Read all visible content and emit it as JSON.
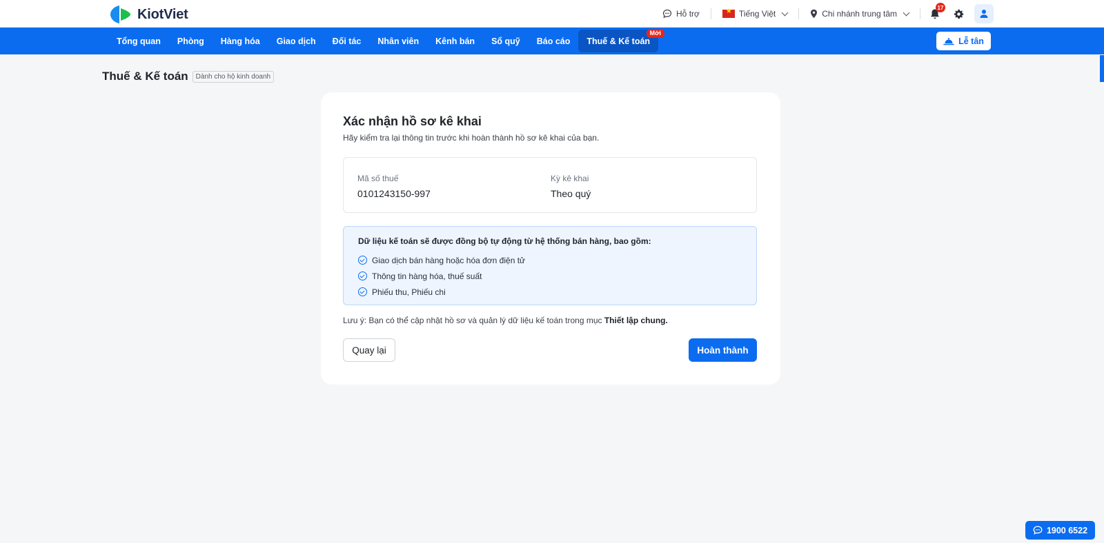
{
  "app": {
    "brand": "KiotViet",
    "colors": {
      "primary": "#0b6cf0",
      "primary_dark": "#0a55c4",
      "danger": "#e5271c",
      "background": "#f5f6f8"
    }
  },
  "header": {
    "support_label": "Hỗ trợ",
    "language_label": "Tiếng Việt",
    "branch_label": "Chi nhánh trung tâm",
    "notification_count": "17",
    "icons": [
      "chat-bubble-icon",
      "vietnam-flag-icon",
      "location-pin-icon",
      "bell-icon",
      "gear-icon",
      "user-icon"
    ]
  },
  "nav": {
    "items": [
      {
        "label": "Tổng quan"
      },
      {
        "label": "Phòng"
      },
      {
        "label": "Hàng hóa"
      },
      {
        "label": "Giao dịch"
      },
      {
        "label": "Đối tác"
      },
      {
        "label": "Nhân viên"
      },
      {
        "label": "Kênh bán"
      },
      {
        "label": "Sổ quỹ"
      },
      {
        "label": "Báo cáo"
      },
      {
        "label": "Thuế & Kế toán",
        "active": true,
        "badge": "Mới"
      }
    ],
    "reception_label": "Lễ tân"
  },
  "page": {
    "title": "Thuế & Kế toán",
    "tag": "Dành cho hộ kinh doanh"
  },
  "card": {
    "title": "Xác nhận hồ sơ kê khai",
    "subtitle": "Hãy kiểm tra lại thông tin trước khi hoàn thành hồ sơ kê khai của bạn.",
    "tax_code_label": "Mã số thuế",
    "tax_code_value": "0101243150-997",
    "period_label": "Kỳ kê khai",
    "period_value": "Theo quý",
    "sync_title": "Dữ liệu kế toán sẽ được đồng bộ tự động từ hệ thống bán hàng, bao gồm:",
    "sync_items": [
      "Giao dịch bán hàng hoặc hóa đơn điện tử",
      "Thông tin hàng hóa, thuế suất",
      "Phiếu thu, Phiếu chi"
    ],
    "note_prefix": "Lưu ý: Bạn có thể cập nhật hồ sơ và quản lý dữ liệu kế toán trong mục ",
    "note_link": "Thiết lập chung.",
    "back_label": "Quay lại",
    "done_label": "Hoàn thành"
  },
  "hotline": {
    "number": "1900 6522"
  }
}
